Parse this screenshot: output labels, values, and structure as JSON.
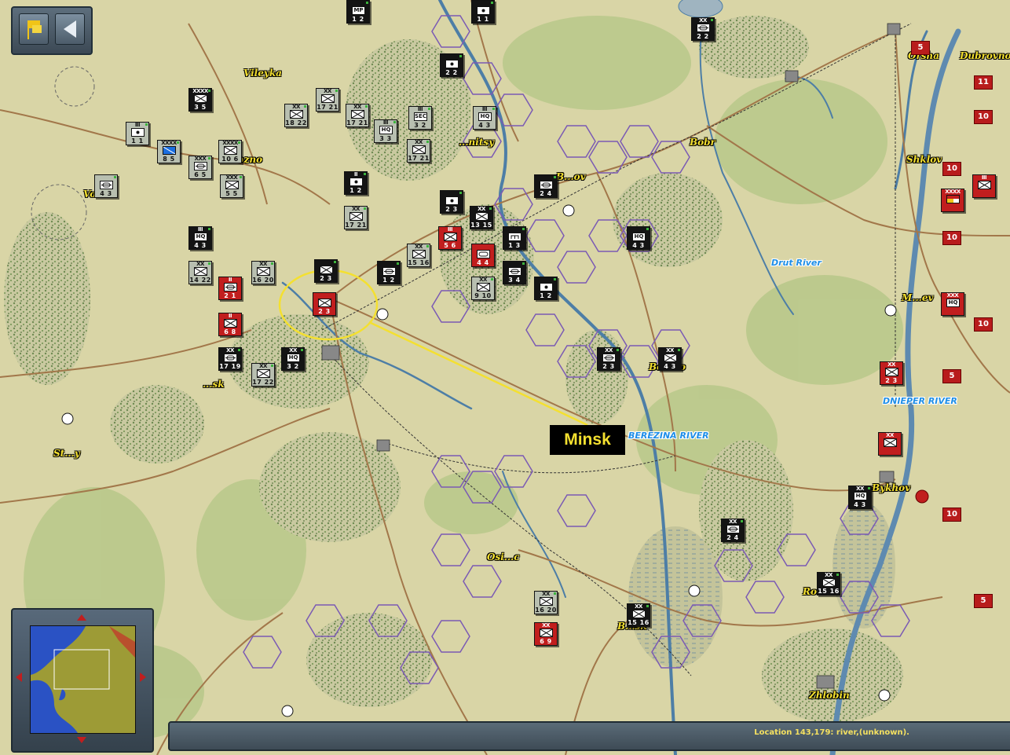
{
  "callout": {
    "label": "Minsk"
  },
  "status": {
    "location_text": "Location 143,179: river,(unknown)."
  },
  "controls": {
    "flag_icon": "flag-icon",
    "back_icon": "back-arrow-icon"
  },
  "cities": [
    {
      "id": "vileyka",
      "name": "Vileyka"
    },
    {
      "id": "orsha",
      "name": "Orsha"
    },
    {
      "id": "dubrovno",
      "name": "Dubrovno"
    },
    {
      "id": "bobr",
      "name": "Bobr"
    },
    {
      "id": "shklov",
      "name": "Shklov"
    },
    {
      "id": "bykhov",
      "name": "Bykhov"
    },
    {
      "id": "zhlobin",
      "name": "Zhlobin"
    },
    {
      "id": "mogilev",
      "name": "M...ev"
    },
    {
      "id": "molodechno",
      "name": "...ozno"
    },
    {
      "id": "volozhin",
      "name": "Vo...n"
    },
    {
      "id": "smilovichi",
      "name": "...sk"
    },
    {
      "id": "borisov",
      "name": "B...ov"
    },
    {
      "id": "berezino",
      "name": "Be...no"
    },
    {
      "id": "cherven",
      "name": "...nitsy"
    },
    {
      "id": "osipovichi",
      "name": "Osi...c"
    },
    {
      "id": "bobruysk",
      "name": "B...sk"
    },
    {
      "id": "rogachev",
      "name": "Ro...ev"
    },
    {
      "id": "stolbtsy",
      "name": "St...y"
    }
  ],
  "rivers": [
    {
      "id": "drut",
      "name": "Drut River"
    },
    {
      "id": "dnieper",
      "name": "DNIEPER RIVER"
    },
    {
      "id": "berezina",
      "name": "BEREZINA RIVER"
    }
  ],
  "units": [
    {
      "side": "sovd",
      "size": "",
      "sym": "mp",
      "str": "1 2"
    },
    {
      "side": "sovd",
      "size": "",
      "sym": "art",
      "str": "1 1"
    },
    {
      "side": "sovd",
      "size": "XX",
      "sym": "mot",
      "str": "2 2"
    },
    {
      "side": "sovd",
      "size": "",
      "sym": "art",
      "str": "2 2"
    },
    {
      "side": "sovd",
      "size": "XXXX",
      "sym": "inf",
      "str": "3 5"
    },
    {
      "side": "sov",
      "size": "III",
      "sym": "art",
      "str": "1 1"
    },
    {
      "side": "sov",
      "size": "XX",
      "sym": "inf",
      "str": "17 21"
    },
    {
      "side": "sov",
      "size": "XX",
      "sym": "inf",
      "str": "18 22"
    },
    {
      "side": "sov",
      "size": "XX",
      "sym": "inf",
      "str": "17 21"
    },
    {
      "side": "sov",
      "size": "III",
      "sym": "hq",
      "str": "3 3"
    },
    {
      "side": "sov",
      "size": "III",
      "sym": "sec",
      "str": "3 2"
    },
    {
      "side": "sov",
      "size": "XX",
      "sym": "inf",
      "str": "17 21"
    },
    {
      "side": "sov",
      "size": "III",
      "sym": "hq",
      "str": "4 3"
    },
    {
      "side": "sov",
      "size": "XXXX",
      "sym": "blue",
      "str": "8 5"
    },
    {
      "side": "sov",
      "size": "XXX",
      "sym": "mot",
      "str": "6 5"
    },
    {
      "side": "sov",
      "size": "XXXX",
      "sym": "inf",
      "str": "10 6"
    },
    {
      "side": "sov",
      "size": "",
      "sym": "mot",
      "str": "4 3"
    },
    {
      "side": "sov",
      "size": "XXX",
      "sym": "inf",
      "str": "5 5"
    },
    {
      "side": "sovd",
      "size": "II",
      "sym": "art",
      "str": "1 2"
    },
    {
      "side": "sovd",
      "size": "",
      "sym": "mot",
      "str": "2 4"
    },
    {
      "side": "sovd",
      "size": "",
      "sym": "art",
      "str": "2 3"
    },
    {
      "side": "sovd",
      "size": "",
      "sym": "inf",
      "str": "2 3"
    },
    {
      "side": "sovd",
      "size": "",
      "sym": "hq",
      "str": "4 3"
    },
    {
      "side": "sovd",
      "size": "III",
      "sym": "hq",
      "str": "4 3"
    },
    {
      "side": "sovd",
      "size": "XX",
      "sym": "inf",
      "str": "13 15"
    },
    {
      "side": "sovd",
      "size": "",
      "sym": "eng",
      "str": "1 3"
    },
    {
      "side": "sovd",
      "size": "",
      "sym": "mot",
      "str": "1 2"
    },
    {
      "side": "sovd",
      "size": "",
      "sym": "mot",
      "str": "3 4"
    },
    {
      "side": "sovd",
      "size": "",
      "sym": "art",
      "str": "1 2"
    },
    {
      "side": "ger",
      "size": "III",
      "sym": "inf",
      "str": "5 6"
    },
    {
      "side": "ger",
      "size": "",
      "sym": "arm",
      "str": "4 4"
    },
    {
      "side": "ger",
      "size": "II",
      "sym": "mot",
      "str": "2 1"
    },
    {
      "side": "ger",
      "size": "II",
      "sym": "inf",
      "str": "6 8"
    },
    {
      "side": "ger",
      "size": "",
      "sym": "inf",
      "str": "2 3"
    },
    {
      "side": "sov",
      "size": "XX",
      "sym": "inf",
      "str": "15 16"
    },
    {
      "side": "sov",
      "size": "XX",
      "sym": "inf",
      "str": "16 20"
    },
    {
      "side": "sov",
      "size": "XX",
      "sym": "inf",
      "str": "14 22"
    },
    {
      "side": "sov",
      "size": "XX",
      "sym": "inf",
      "str": "17 21"
    },
    {
      "side": "sov",
      "size": "XX",
      "sym": "inf",
      "str": "9 10"
    },
    {
      "side": "sovd",
      "size": "XX",
      "sym": "hq",
      "str": "3 2"
    },
    {
      "side": "sov",
      "size": "XX",
      "sym": "inf",
      "str": "17 22"
    },
    {
      "side": "sovd",
      "size": "XX",
      "sym": "mot",
      "str": "17 19"
    },
    {
      "side": "ger",
      "size": "XX",
      "sym": "inf",
      "str": "6 9"
    },
    {
      "side": "sovd",
      "size": "XX",
      "sym": "inf",
      "str": "15 16"
    },
    {
      "side": "sovd",
      "size": "XX",
      "sym": "mot",
      "str": "2 4"
    },
    {
      "side": "sovd",
      "size": "XX",
      "sym": "inf",
      "str": "15 16"
    },
    {
      "side": "sovd",
      "size": "XX",
      "sym": "hq",
      "str": "4 3"
    },
    {
      "side": "sov",
      "size": "XX",
      "sym": "inf",
      "str": "16 20"
    },
    {
      "side": "sovd",
      "size": "XX",
      "sym": "mot",
      "str": "2 3"
    },
    {
      "side": "sovd",
      "size": "XX",
      "sym": "inf",
      "str": "4 3"
    },
    {
      "side": "ger",
      "size": "XX",
      "sym": "inf",
      "str": "2 3"
    },
    {
      "side": "ger",
      "size": "XXX",
      "sym": "hq",
      "str": ""
    },
    {
      "side": "ger",
      "size": "XX",
      "sym": "inf",
      "str": ""
    },
    {
      "side": "ger",
      "size": "XXXX",
      "sym": "mix",
      "str": ""
    },
    {
      "side": "ger",
      "size": "III",
      "sym": "inf",
      "str": ""
    }
  ],
  "markers": [
    {
      "label": "5"
    },
    {
      "label": "5"
    },
    {
      "label": "10"
    },
    {
      "label": "10"
    },
    {
      "label": "10"
    },
    {
      "label": "10"
    },
    {
      "label": "5"
    },
    {
      "label": "10"
    },
    {
      "label": "5"
    },
    {
      "label": "11"
    }
  ]
}
